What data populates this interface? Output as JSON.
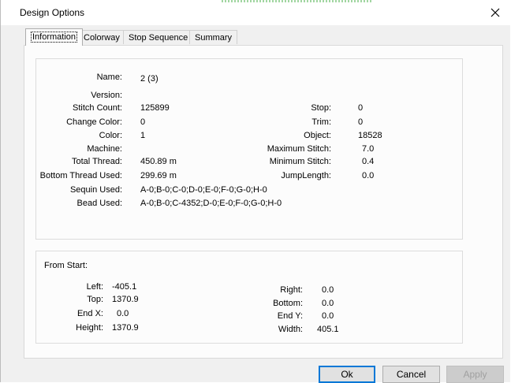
{
  "window": {
    "title": "Design Options",
    "close_icon": "close-icon"
  },
  "tabs": [
    {
      "label": "Information",
      "active": true
    },
    {
      "label": "Colorway"
    },
    {
      "label": "Stop Sequence"
    },
    {
      "label": "Summary"
    }
  ],
  "info": {
    "left": [
      {
        "label": "Name:",
        "value": "2 (3)"
      },
      {
        "label": "Version:",
        "value": ""
      },
      {
        "label": "Stitch Count:",
        "value": "125899"
      },
      {
        "label": "Change Color:",
        "value": "0"
      },
      {
        "label": "Color:",
        "value": "1"
      },
      {
        "label": "Machine:",
        "value": ""
      },
      {
        "label": "Total Thread:",
        "value": "450.89 m"
      },
      {
        "label": "Bottom Thread Used:",
        "value": "299.69 m"
      },
      {
        "label": "Sequin Used:",
        "value": "A-0;B-0;C-0;D-0;E-0;F-0;G-0;H-0"
      },
      {
        "label": "Bead Used:",
        "value": "A-0;B-0;C-4352;D-0;E-0;F-0;G-0;H-0"
      }
    ],
    "right": [
      {
        "label": "Stop:",
        "value": "0"
      },
      {
        "label": "Trim:",
        "value": "0"
      },
      {
        "label": "Object:",
        "value": "18528"
      },
      {
        "label": "Maximum Stitch:",
        "value": "7.0"
      },
      {
        "label": "Minimum Stitch:",
        "value": "0.4"
      },
      {
        "label": "JumpLength:",
        "value": "0.0"
      }
    ]
  },
  "from_start": {
    "title": "From Start:",
    "left": [
      {
        "label": "Left:",
        "value": "-405.1"
      },
      {
        "label": "Top:",
        "value": "1370.9"
      },
      {
        "label": "End X:",
        "value": "0.0"
      },
      {
        "label": "Height:",
        "value": "1370.9"
      }
    ],
    "right": [
      {
        "label": "Right:",
        "value": "0.0"
      },
      {
        "label": "Bottom:",
        "value": "0.0"
      },
      {
        "label": "End Y:",
        "value": "0.0"
      },
      {
        "label": "Width:",
        "value": "405.1"
      }
    ]
  },
  "buttons": {
    "ok": "Ok",
    "cancel": "Cancel",
    "apply": "Apply"
  }
}
